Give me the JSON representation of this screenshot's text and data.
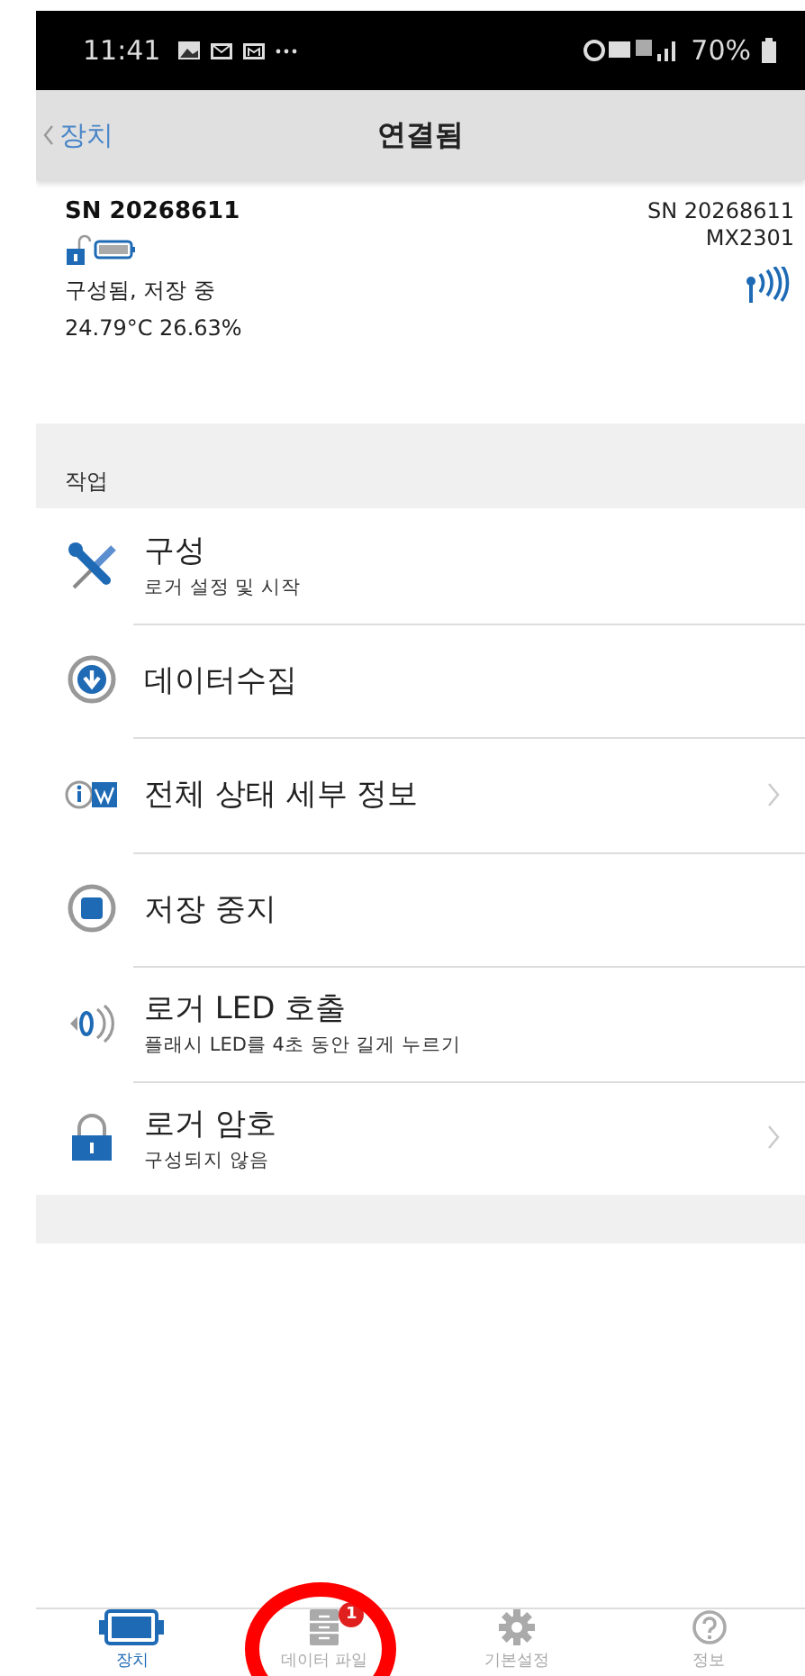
{
  "status_bar": {
    "time": "11:41",
    "battery": "70%"
  },
  "header": {
    "back": "장치",
    "title": "연결됨"
  },
  "device": {
    "serial": "SN 20268611",
    "status": "구성됨, 저장 중",
    "readings": "24.79°C  26.63%",
    "serial_right": "SN 20268611",
    "model": "MX2301"
  },
  "section": {
    "title": "작업"
  },
  "actions": [
    {
      "kind": "wrench",
      "title": "구성",
      "subtitle": "로거 설정 및 시작",
      "chevron": false
    },
    {
      "kind": "download",
      "title": "데이터수집",
      "chevron": false
    },
    {
      "kind": "status",
      "title": "전체 상태 세부 정보",
      "chevron": true
    },
    {
      "kind": "stop",
      "title": "저장 중지",
      "chevron": false
    },
    {
      "kind": "sound",
      "title": "로거 LED 호출",
      "subtitle": "플래시 LED를 4초 동안 길게 누르기",
      "chevron": false
    },
    {
      "kind": "lock",
      "title": "로거 암호",
      "subtitle": "구성되지 않음",
      "chevron": true
    }
  ],
  "tabs": [
    {
      "kind": "device",
      "label": "장치",
      "selected": true
    },
    {
      "kind": "files",
      "label": "데이터 파일",
      "selected": false,
      "badge": "1",
      "circled": true
    },
    {
      "kind": "gear",
      "label": "기본설정",
      "selected": false
    },
    {
      "kind": "help",
      "label": "정보",
      "selected": false
    }
  ]
}
